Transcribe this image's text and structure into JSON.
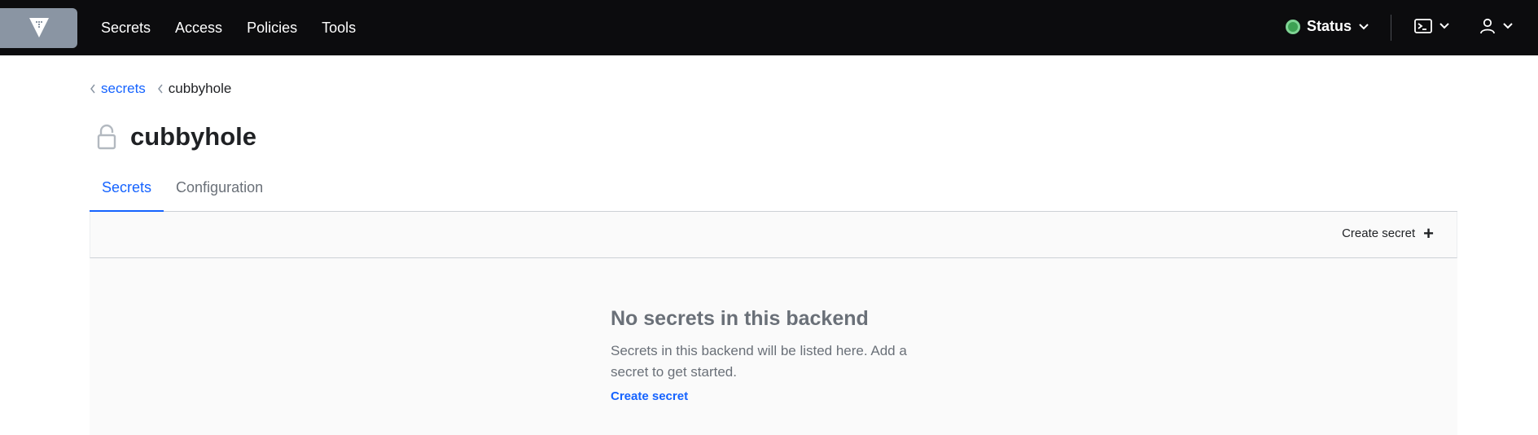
{
  "nav": {
    "links": [
      "Secrets",
      "Access",
      "Policies",
      "Tools"
    ],
    "status_label": "Status",
    "status_color": "#3da153"
  },
  "breadcrumb": {
    "parent": "secrets",
    "current": "cubbyhole"
  },
  "page": {
    "title": "cubbyhole"
  },
  "tabs": [
    {
      "label": "Secrets",
      "active": true
    },
    {
      "label": "Configuration",
      "active": false
    }
  ],
  "toolbar": {
    "create_label": "Create secret",
    "create_icon": "plus"
  },
  "empty_state": {
    "title": "No secrets in this backend",
    "message": "Secrets in this backend will be listed here. Add a secret to get started.",
    "link": "Create secret"
  },
  "colors": {
    "accent": "#1563ff",
    "nav_bg": "#0c0c0e",
    "logo_bg": "#8a95a3"
  }
}
